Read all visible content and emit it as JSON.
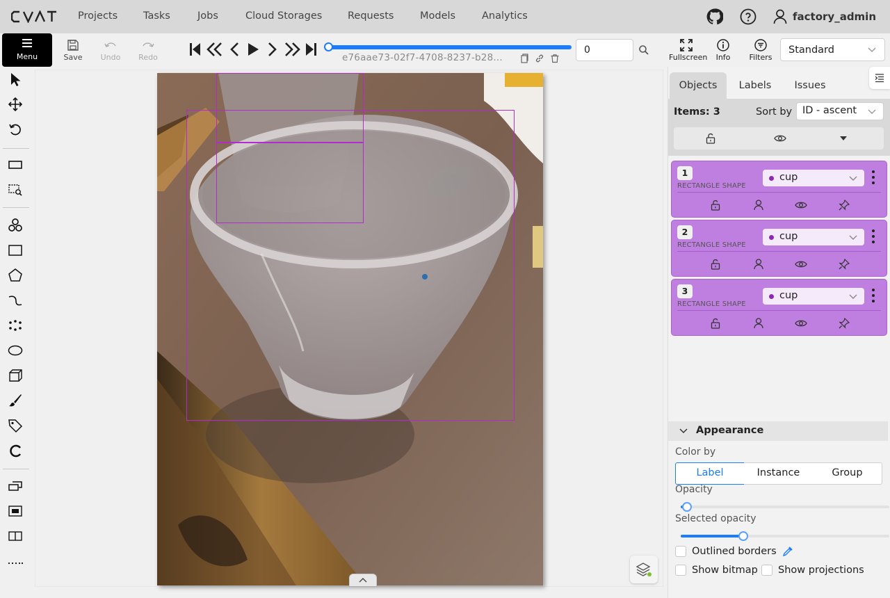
{
  "app": {
    "logo_text": "CVAT",
    "nav": [
      "Projects",
      "Tasks",
      "Jobs",
      "Cloud Storages",
      "Requests",
      "Models",
      "Analytics"
    ],
    "user_name": "factory_admin"
  },
  "toolbar": {
    "menu_label": "Menu",
    "save_label": "Save",
    "undo_label": "Undo",
    "redo_label": "Redo",
    "filename": "e76aae73-02f7-4708-8237-b28...",
    "frame_value": "0",
    "frame_progress": 0,
    "fullscreen_label": "Fullscreen",
    "info_label": "Info",
    "filters_label": "Filters",
    "workspace_value": "Standard"
  },
  "sidebar": {
    "tabs": [
      "Objects",
      "Labels",
      "Issues"
    ],
    "items_count": "Items: 3",
    "sort_label": "Sort by",
    "sort_value": "ID - ascent",
    "objects": [
      {
        "id": "1",
        "kind": "RECTANGLE SHAPE",
        "label": "cup"
      },
      {
        "id": "2",
        "kind": "RECTANGLE SHAPE",
        "label": "cup"
      },
      {
        "id": "3",
        "kind": "RECTANGLE SHAPE",
        "label": "cup"
      }
    ]
  },
  "appearance": {
    "title": "Appearance",
    "color_by_label": "Color by",
    "color_by_options": [
      "Label",
      "Instance",
      "Group"
    ],
    "color_by_selected": "Label",
    "opacity_label": "Opacity",
    "opacity_value": 0.03,
    "selected_opacity_label": "Selected opacity",
    "selected_opacity_value": 0.3,
    "outlined_borders_label": "Outlined borders",
    "show_bitmap_label": "Show bitmap",
    "show_projections_label": "Show projections"
  },
  "colors": {
    "accent": "#1a7cff",
    "object_card": "#bf7fe0",
    "bbox": "#b32bcc"
  }
}
